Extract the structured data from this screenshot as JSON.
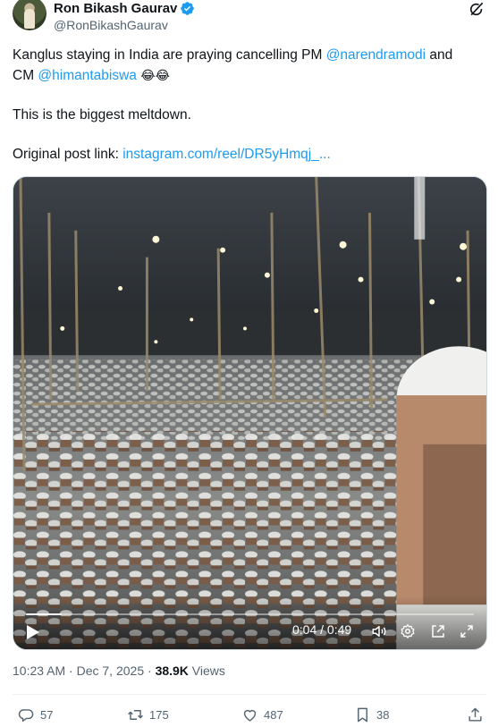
{
  "author": {
    "display_name": "Ron Bikash Gaurav",
    "handle": "@RonBikashGaurav",
    "verified": true
  },
  "tweet": {
    "line1_prefix": "Kanglus staying in India are praying cancelling PM ",
    "mention1": "@narendramodi",
    "line1_suffix": " and",
    "line2_prefix": "CM ",
    "mention2": "@himantabiswa",
    "emoji": "😂😂",
    "line3": "This is the biggest meltdown.",
    "link_label": "Original post link: ",
    "link_text": "instagram.com/reel/DR5yHmqj_..."
  },
  "video": {
    "current_time": "0:04",
    "separator": " / ",
    "duration": "0:49",
    "progress_fraction": 0.08,
    "icons": [
      "play-icon",
      "volume-icon",
      "settings-icon",
      "pip-icon",
      "fullscreen-icon"
    ]
  },
  "meta": {
    "time": "10:23 AM",
    "dot": " · ",
    "date": "Dec 7, 2025",
    "dot2": " · ",
    "views_count": "38.9K",
    "views_label": " Views"
  },
  "actions": {
    "replies": "57",
    "reposts": "175",
    "likes": "487",
    "bookmarks": "38"
  },
  "colors": {
    "accent": "#1d9bf0",
    "text": "#0f1419",
    "muted": "#536471"
  }
}
